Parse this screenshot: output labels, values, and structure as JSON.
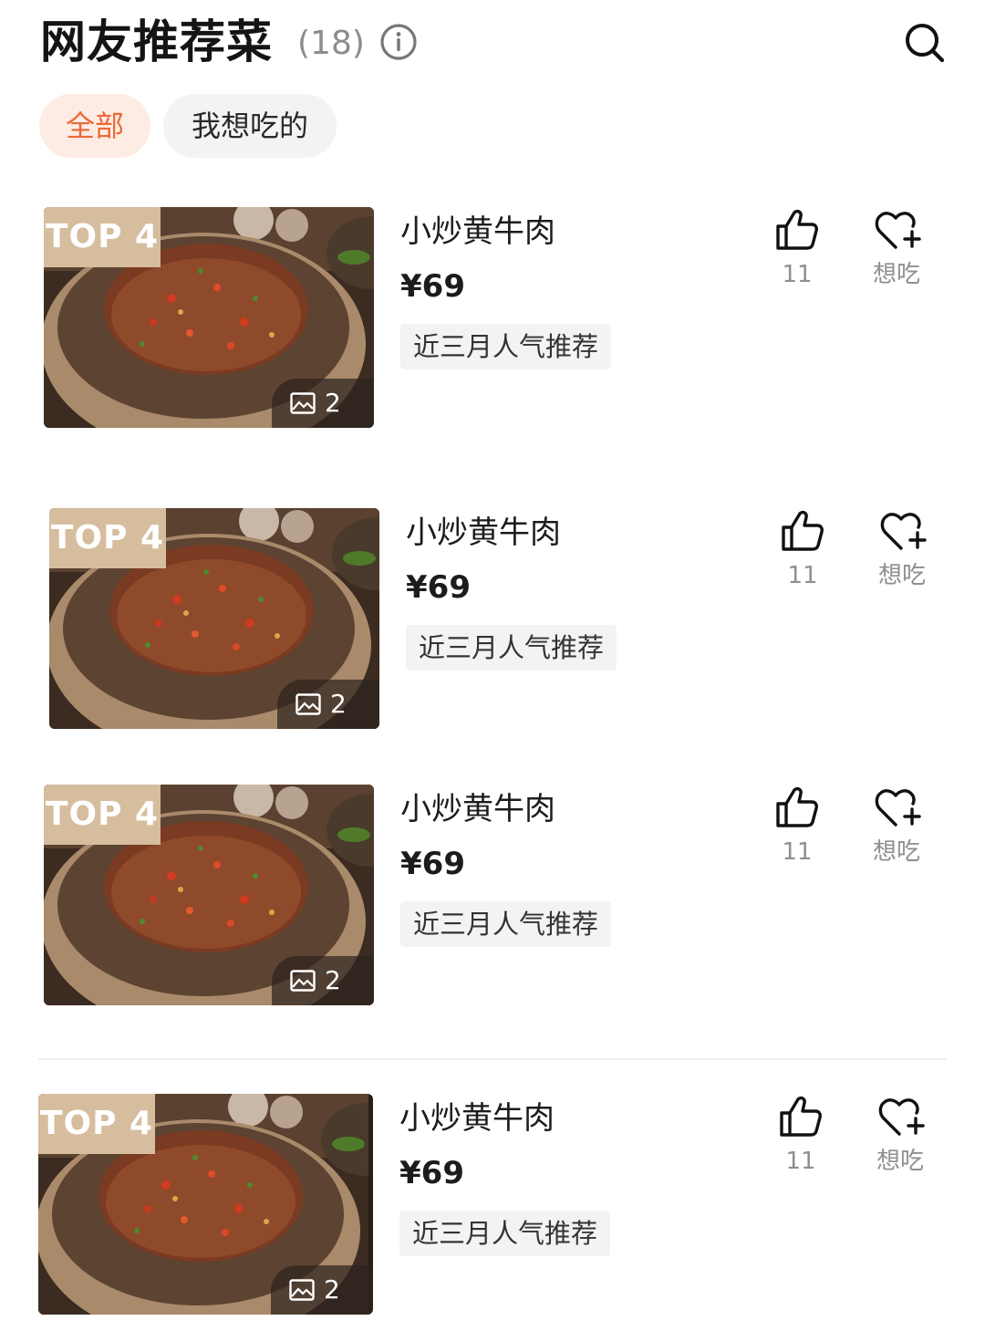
{
  "header": {
    "title": "网友推荐菜",
    "count": "(18)"
  },
  "filters": {
    "all_label": "全部",
    "want_label": "我想吃的",
    "selected": "全部"
  },
  "icons": {
    "info": "info-icon",
    "search": "search-icon",
    "like": "thumbs-up-icon",
    "want": "heart-plus-icon",
    "gallery": "image-icon"
  },
  "colors": {
    "accent": "#ec6838",
    "accent_bg": "#fdece4",
    "badge": "#d5bd9e",
    "muted": "#8f8f8f"
  },
  "dishes": [
    {
      "rank": "TOP 4",
      "photo_count": "2",
      "name": "小炒黄牛肉",
      "price": "¥69",
      "tag": "近三月人气推荐",
      "likes": "11",
      "want_label": "想吃"
    },
    {
      "rank": "TOP 4",
      "photo_count": "2",
      "name": "小炒黄牛肉",
      "price": "¥69",
      "tag": "近三月人气推荐",
      "likes": "11",
      "want_label": "想吃"
    },
    {
      "rank": "TOP 4",
      "photo_count": "2",
      "name": "小炒黄牛肉",
      "price": "¥69",
      "tag": "近三月人气推荐",
      "likes": "11",
      "want_label": "想吃"
    },
    {
      "rank": "TOP 4",
      "photo_count": "2",
      "name": "小炒黄牛肉",
      "price": "¥69",
      "tag": "近三月人气推荐",
      "likes": "11",
      "want_label": "想吃"
    }
  ]
}
